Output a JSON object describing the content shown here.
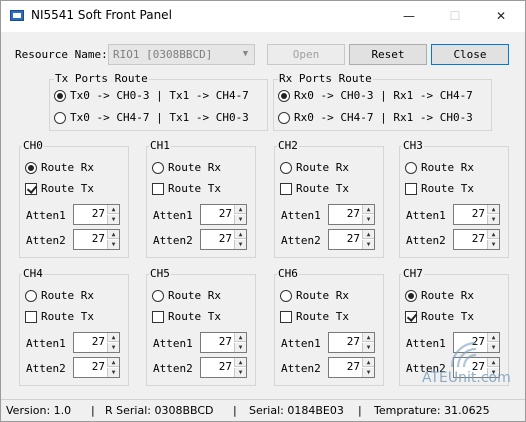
{
  "window": {
    "title": "NI5541 Soft Front Panel",
    "minimize": "—",
    "maximize": "☐",
    "close": "✕"
  },
  "resource": {
    "label": "Resource Name:",
    "value": "RIO1 [0308BBCD]",
    "open_label": "Open",
    "reset_label": "Reset",
    "close_label": "Close"
  },
  "tx_route": {
    "title": "Tx Ports Route",
    "options": [
      {
        "label": "Tx0 -> CH0-3 | Tx1 -> CH4-7",
        "selected": true
      },
      {
        "label": "Tx0 -> CH4-7 | Tx1 -> CH0-3",
        "selected": false
      }
    ]
  },
  "rx_route": {
    "title": "Rx Ports Route",
    "options": [
      {
        "label": "Rx0 -> CH0-3 | Rx1 -> CH4-7",
        "selected": true
      },
      {
        "label": "Rx0 -> CH4-7 | Rx1 -> CH0-3",
        "selected": false
      }
    ]
  },
  "channels": [
    {
      "name": "CH0",
      "route_rx_label": "Route Rx",
      "route_rx": true,
      "route_tx_label": "Route Tx",
      "route_tx": true,
      "atten1_label": "Atten1",
      "atten1": "27",
      "atten2_label": "Atten2",
      "atten2": "27"
    },
    {
      "name": "CH1",
      "route_rx_label": "Route Rx",
      "route_rx": false,
      "route_tx_label": "Route Tx",
      "route_tx": false,
      "atten1_label": "Atten1",
      "atten1": "27",
      "atten2_label": "Atten2",
      "atten2": "27"
    },
    {
      "name": "CH2",
      "route_rx_label": "Route Rx",
      "route_rx": false,
      "route_tx_label": "Route Tx",
      "route_tx": false,
      "atten1_label": "Atten1",
      "atten1": "27",
      "atten2_label": "Atten2",
      "atten2": "27"
    },
    {
      "name": "CH3",
      "route_rx_label": "Route Rx",
      "route_rx": false,
      "route_tx_label": "Route Tx",
      "route_tx": false,
      "atten1_label": "Atten1",
      "atten1": "27",
      "atten2_label": "Atten2",
      "atten2": "27"
    },
    {
      "name": "CH4",
      "route_rx_label": "Route Rx",
      "route_rx": false,
      "route_tx_label": "Route Tx",
      "route_tx": false,
      "atten1_label": "Atten1",
      "atten1": "27",
      "atten2_label": "Atten2",
      "atten2": "27"
    },
    {
      "name": "CH5",
      "route_rx_label": "Route Rx",
      "route_rx": false,
      "route_tx_label": "Route Tx",
      "route_tx": false,
      "atten1_label": "Atten1",
      "atten1": "27",
      "atten2_label": "Atten2",
      "atten2": "27"
    },
    {
      "name": "CH6",
      "route_rx_label": "Route Rx",
      "route_rx": false,
      "route_tx_label": "Route Tx",
      "route_tx": false,
      "atten1_label": "Atten1",
      "atten1": "27",
      "atten2_label": "Atten2",
      "atten2": "27"
    },
    {
      "name": "CH7",
      "route_rx_label": "Route Rx",
      "route_rx": true,
      "route_tx_label": "Route Tx",
      "route_tx": true,
      "atten1_label": "Atten1",
      "atten1": "27",
      "atten2_label": "Atten2",
      "atten2": "27"
    }
  ],
  "spin_glyphs": {
    "up": "▲",
    "down": "▼",
    "dropdown": "▼"
  },
  "status": {
    "version": "Version:  1.0",
    "sep1": "|",
    "r_serial": "R Serial:  0308BBCD",
    "sep2": "|",
    "serial": "Serial:  0184BE03",
    "sep3": "|",
    "temperature": "Temprature:  31.0625"
  },
  "watermark": {
    "text": "ATEUnit.com"
  }
}
